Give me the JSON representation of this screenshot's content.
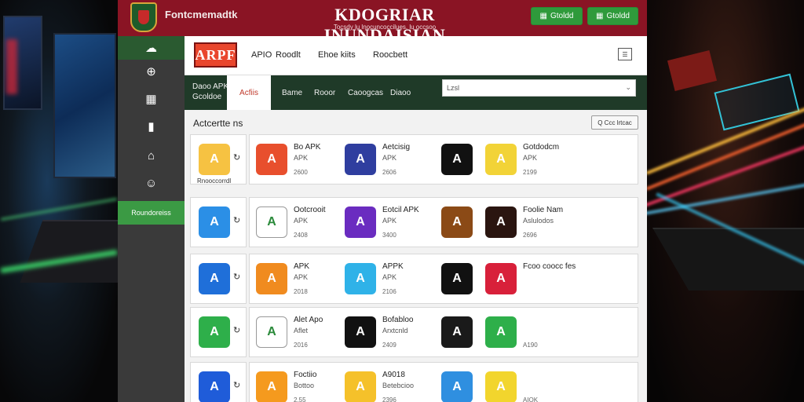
{
  "site": {
    "brand": "Fontcmemadtk",
    "title": "KDOGRIAR INUNDAISIAN",
    "subtitle": "Tocsdy lu lnocuncoccilues, lu occsoo",
    "btn1": "Gtoldd",
    "btn2": "Gtoldd"
  },
  "header": {
    "logo": "ARPF",
    "nav": [
      "APIO",
      "Roodlt",
      "Ehoe kiits",
      "Roocbett"
    ]
  },
  "tabs": {
    "brand_line1": "Daoo APK",
    "brand_line2": "Gcoldoe",
    "active": "Acfiis",
    "items": [
      "Bame",
      "Rooor",
      "Caoogcas",
      "Diaoo"
    ],
    "search_placeholder": "Lzsl"
  },
  "sidebar": {
    "label": "Roundoreiss"
  },
  "content": {
    "section_title": "Actcertte ns",
    "filter_btn": "Q Ccc lrtcac"
  },
  "rows": [
    {
      "left": {
        "label": "Rnooccorrdl",
        "color": "#f6c242"
      },
      "apps": [
        {
          "name": "Bo APK",
          "sub": "APK",
          "size": "2600",
          "color": "#e84f2d"
        },
        {
          "name": "Aetcisig",
          "sub": "APK",
          "size": "2606",
          "color": "#2f3e9f"
        },
        {
          "name": "",
          "sub": "",
          "size": "",
          "color": "#111111"
        },
        {
          "name": "Gotdodcm",
          "sub": "APK",
          "size": "2199",
          "color": "#f2d337"
        }
      ]
    },
    {
      "left": {
        "label": "",
        "color": "#2b8fe6"
      },
      "apps": [
        {
          "name": "Ootcrooit",
          "sub": "APK",
          "size": "2408",
          "color": "#ffffff"
        },
        {
          "name": "Eotcil APK",
          "sub": "APK",
          "size": "3400",
          "color": "#6a2cc0"
        },
        {
          "name": "",
          "sub": "",
          "size": "",
          "color": "#8b4a16"
        },
        {
          "name": "Foolie Nam",
          "sub": "Aslulodos",
          "size": "2696",
          "color": "#2a1510"
        }
      ]
    },
    {
      "left": {
        "label": "",
        "color": "#1f6fd9"
      },
      "apps": [
        {
          "name": "APK",
          "sub": "APK",
          "size": "2018",
          "color": "#f08b1f"
        },
        {
          "name": "APPK",
          "sub": "APK",
          "size": "2106",
          "color": "#2fb2e8"
        },
        {
          "name": "",
          "sub": "",
          "size": "",
          "color": "#111111"
        },
        {
          "name": "Fcoo coocc fes",
          "sub": "",
          "size": "",
          "color": "#d8203a"
        }
      ]
    },
    {
      "left": {
        "label": "",
        "color": "#2eaf4a"
      },
      "apps": [
        {
          "name": "Alet Apo",
          "sub": "Aflet",
          "size": "2016",
          "color": "#ffffff"
        },
        {
          "name": "Bofabloo",
          "sub": "Arxtcnld",
          "size": "2409",
          "color": "#111111"
        },
        {
          "name": "",
          "sub": "",
          "size": "",
          "color": "#1a1a1a"
        },
        {
          "name": "",
          "sub": "",
          "size": "A190",
          "color": "#2eaf4a"
        }
      ]
    },
    {
      "left": {
        "label": "",
        "color": "#1f5cd9"
      },
      "apps": [
        {
          "name": "Foctiio",
          "sub": "Bottoo",
          "size": "2.55",
          "color": "#f59a1e"
        },
        {
          "name": "A9018",
          "sub": "Betebcioo",
          "size": "2396",
          "color": "#f5c12a"
        },
        {
          "name": "",
          "sub": "",
          "size": "",
          "color": "#2f8fe0"
        },
        {
          "name": "",
          "sub": "",
          "size": "AIOK",
          "color": "#f2d52d"
        }
      ]
    }
  ]
}
